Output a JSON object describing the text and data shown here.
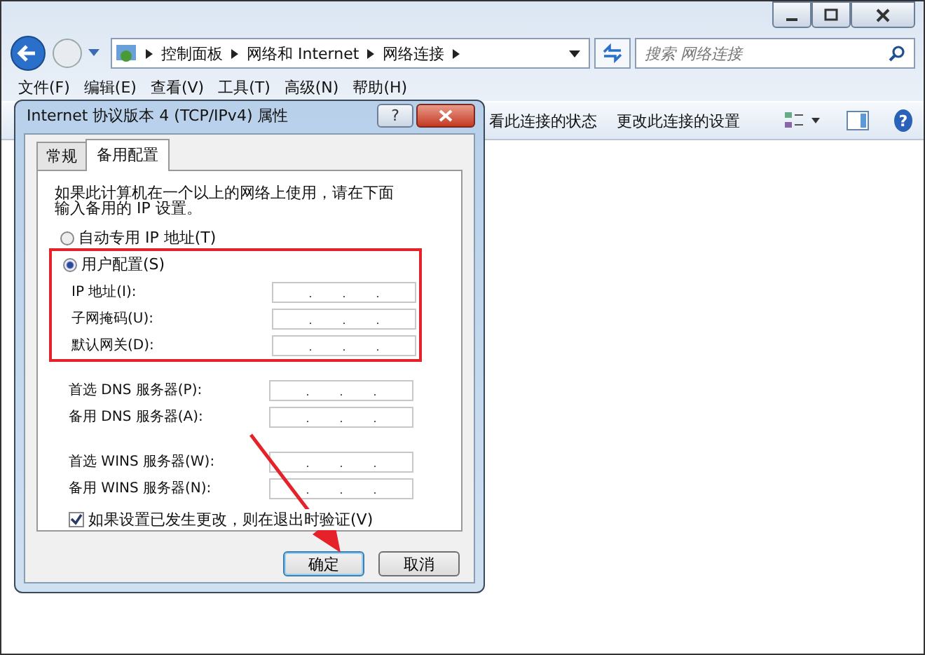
{
  "address_bar": {
    "crumbs": [
      "控制面板",
      "网络和 Internet",
      "网络连接"
    ]
  },
  "search": {
    "placeholder": "搜索 网络连接"
  },
  "menu": [
    "文件(F)",
    "编辑(E)",
    "查看(V)",
    "工具(T)",
    "高级(N)",
    "帮助(H)"
  ],
  "command_bar": {
    "items": [
      "看此连接的状态",
      "更改此连接的设置"
    ],
    "help": "?"
  },
  "dialog": {
    "title": "Internet 协议版本 4 (TCP/IPv4) 属性",
    "help": "?",
    "tabs": [
      {
        "label": "常规",
        "selected": false
      },
      {
        "label": "备用配置",
        "selected": true
      }
    ],
    "description": "如果此计算机在一个以上的网络上使用，请在下面输入备用的 IP 设置。",
    "options": [
      {
        "label": "自动专用 IP 地址(T)",
        "selected": false
      },
      {
        "label": "用户配置(S)",
        "selected": true
      }
    ],
    "user_fields": [
      {
        "label": "IP 地址(I):"
      },
      {
        "label": "子网掩码(U):"
      },
      {
        "label": "默认网关(D):"
      }
    ],
    "dns_fields": [
      {
        "label": "首选 DNS 服务器(P):"
      },
      {
        "label": "备用 DNS 服务器(A):"
      }
    ],
    "wins_fields": [
      {
        "label": "首选 WINS 服务器(W):"
      },
      {
        "label": "备用 WINS 服务器(N):"
      }
    ],
    "checkbox": {
      "label": "如果设置已发生更改，则在退出时验证(V)",
      "checked": true
    },
    "buttons": [
      {
        "label": "确定",
        "default": true
      },
      {
        "label": "取消",
        "default": false
      }
    ]
  }
}
